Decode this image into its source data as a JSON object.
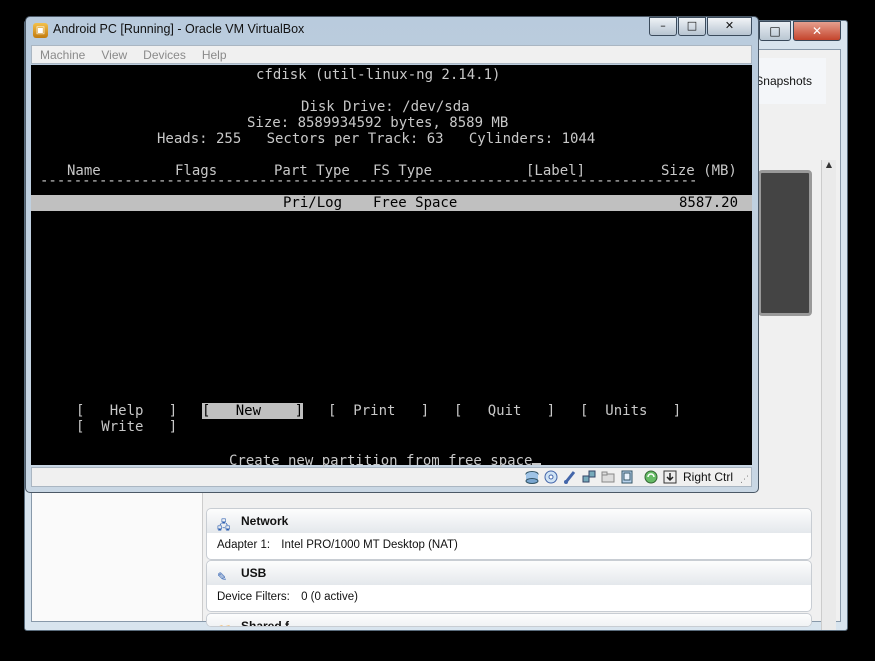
{
  "vm_window": {
    "title": "Android PC [Running] - Oracle VM VirtualBox",
    "controls": {
      "minimize": "–",
      "maximize": "□",
      "close": "✕"
    }
  },
  "menubar": {
    "items": [
      "Machine",
      "View",
      "Devices",
      "Help"
    ]
  },
  "terminal": {
    "program": "cfdisk (util-linux-ng 2.14.1)",
    "disk_drive": "Disk Drive: /dev/sda",
    "size": "Size: 8589934592 bytes, 8589 MB",
    "geometry": "Heads: 255   Sectors per Track: 63   Cylinders: 1044",
    "columns": {
      "name": "Name",
      "flags": "Flags",
      "part_type": "Part Type",
      "fs_type": "FS Type",
      "label": "[Label]",
      "size": "Size (MB)"
    },
    "separator": "------------------------------------------------------------------------------",
    "partition": {
      "part_type": "Pri/Log",
      "fs_type": "Free Space",
      "size": "8587.20"
    },
    "menu": [
      {
        "label": "Help"
      },
      {
        "label": "New"
      },
      {
        "label": "Print"
      },
      {
        "label": "Quit"
      },
      {
        "label": "Units"
      },
      {
        "label": "Write"
      }
    ],
    "selected_action": "New",
    "status_message": "Create new partition from free space"
  },
  "statusbar": {
    "icons": [
      "hard-disk-icon",
      "optical-disk-icon",
      "usb-icon",
      "network-icon",
      "shared-folder-icon",
      "capture-icon",
      "mouse-integration-icon",
      "keyboard-icon"
    ],
    "host_key": "Right Ctrl"
  },
  "background_manager": {
    "snapshots_label": "Snapshots",
    "network": {
      "title": "Network",
      "adapter_label": "Adapter 1:",
      "adapter_value": "Intel PRO/1000 MT Desktop (NAT)"
    },
    "usb": {
      "title": "USB",
      "filters_label": "Device Filters:",
      "filters_value": "0 (0 active)"
    },
    "shared_folders": {
      "title": "Shared f..."
    }
  }
}
